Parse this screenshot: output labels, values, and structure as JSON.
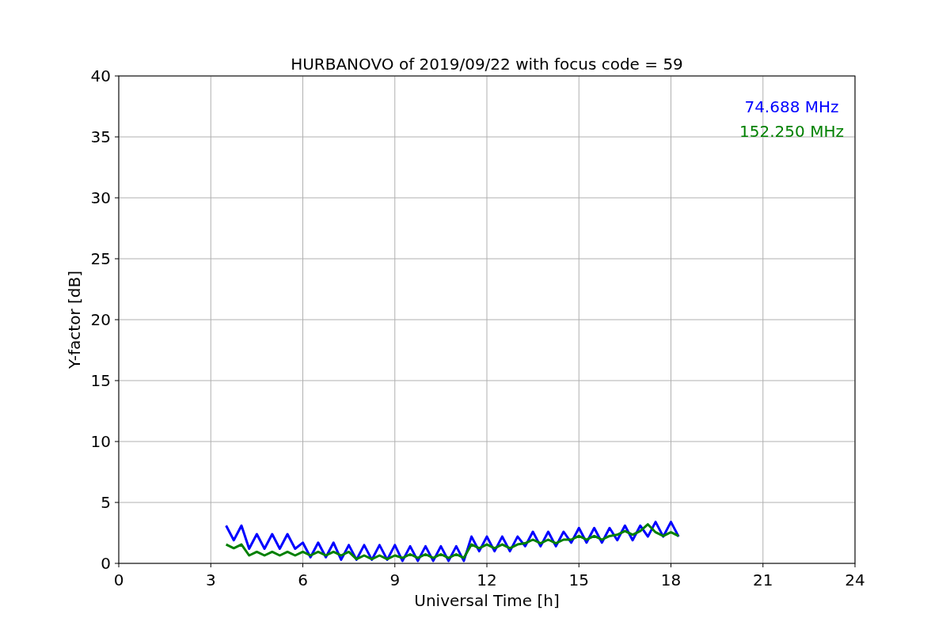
{
  "figure": {
    "chart_data": {
      "type": "line",
      "title": "HURBANOVO of 2019/09/22 with focus code = 59",
      "xlabel": "Universal Time [h]",
      "ylabel": "Y-factor [dB]",
      "grid": true,
      "xlim": [
        0,
        24
      ],
      "ylim": [
        0,
        40
      ],
      "xticks": [
        0,
        3,
        6,
        9,
        12,
        15,
        18,
        21,
        24
      ],
      "yticks": [
        0,
        5,
        10,
        15,
        20,
        25,
        30,
        35,
        40
      ],
      "x": [
        3.5,
        3.75,
        4,
        4.25,
        4.5,
        4.75,
        5,
        5.25,
        5.5,
        5.75,
        6,
        6.25,
        6.5,
        6.75,
        7,
        7.25,
        7.5,
        7.75,
        8,
        8.25,
        8.5,
        8.75,
        9,
        9.25,
        9.5,
        9.75,
        10,
        10.25,
        10.5,
        10.75,
        11,
        11.25,
        11.5,
        11.75,
        12,
        12.25,
        12.5,
        12.75,
        13,
        13.25,
        13.5,
        13.75,
        14,
        14.25,
        14.5,
        14.75,
        15,
        15.25,
        15.5,
        15.75,
        16,
        16.25,
        16.5,
        16.75,
        17,
        17.25,
        17.5,
        17.75,
        18,
        18.25
      ],
      "series": [
        {
          "name": "74.688 MHz",
          "color": "#0000ff",
          "values": [
            3.1,
            1.9,
            3.1,
            1.2,
            2.4,
            1.2,
            2.4,
            1.2,
            2.4,
            1.2,
            1.7,
            0.5,
            1.7,
            0.5,
            1.7,
            0.3,
            1.5,
            0.3,
            1.5,
            0.3,
            1.5,
            0.3,
            1.5,
            0.2,
            1.4,
            0.2,
            1.4,
            0.2,
            1.4,
            0.2,
            1.4,
            0.2,
            2.2,
            1.0,
            2.2,
            1.0,
            2.2,
            1.0,
            2.2,
            1.4,
            2.6,
            1.4,
            2.6,
            1.4,
            2.6,
            1.7,
            2.9,
            1.7,
            2.9,
            1.7,
            2.9,
            1.9,
            3.1,
            1.9,
            3.1,
            2.2,
            3.4,
            2.2,
            3.4,
            2.2
          ]
        },
        {
          "name": "152.250 MHz",
          "color": "#008000",
          "values": [
            1.55,
            1.25,
            1.55,
            0.65,
            0.95,
            0.65,
            0.95,
            0.65,
            0.95,
            0.65,
            0.95,
            0.65,
            0.95,
            0.65,
            0.95,
            0.65,
            0.95,
            0.35,
            0.65,
            0.35,
            0.65,
            0.35,
            0.65,
            0.45,
            0.75,
            0.45,
            0.75,
            0.45,
            0.75,
            0.45,
            0.75,
            0.45,
            1.55,
            1.25,
            1.55,
            1.25,
            1.55,
            1.25,
            1.55,
            1.65,
            1.95,
            1.65,
            1.95,
            1.65,
            1.95,
            1.95,
            2.25,
            1.95,
            2.25,
            1.95,
            2.25,
            2.35,
            2.65,
            2.35,
            2.65,
            3.2,
            2.55,
            2.25,
            2.55,
            2.25
          ]
        }
      ]
    }
  }
}
